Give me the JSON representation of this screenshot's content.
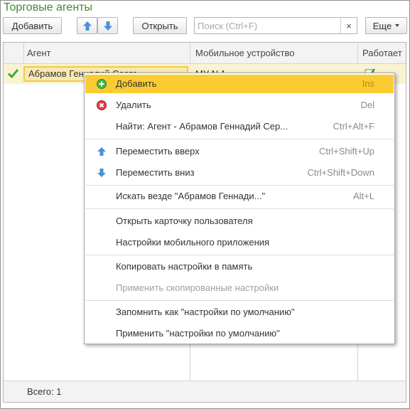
{
  "window": {
    "title": "Торговые агенты"
  },
  "toolbar": {
    "add_label": "Добавить",
    "open_label": "Открыть",
    "search_placeholder": "Поиск (Ctrl+F)",
    "search_clear": "×",
    "more_label": "Еще"
  },
  "table": {
    "columns": [
      "Агент",
      "Мобильное устройство",
      "Работает"
    ],
    "rows": [
      {
        "agent": "Абрамов Геннадий Серге",
        "device": "МУ N 1",
        "works": true
      }
    ],
    "total_label": "Всего: 1"
  },
  "context_menu": {
    "items": [
      {
        "label": "Добавить",
        "shortcut": "Ins",
        "icon": "add-icon",
        "active": true,
        "enabled": true
      },
      {
        "label": "Удалить",
        "shortcut": "Del",
        "icon": "delete-icon",
        "enabled": true
      },
      {
        "label": "Найти: Агент - Абрамов Геннадий Сер...",
        "shortcut": "Ctrl+Alt+F",
        "enabled": true
      },
      {
        "label": "Переместить вверх",
        "shortcut": "Ctrl+Shift+Up",
        "icon": "arrow-up-icon",
        "enabled": true
      },
      {
        "label": "Переместить вниз",
        "shortcut": "Ctrl+Shift+Down",
        "icon": "arrow-down-icon",
        "enabled": true
      },
      {
        "label": "Искать везде \"Абрамов Геннади...\"",
        "shortcut": "Alt+L",
        "enabled": true
      },
      {
        "label": "Открыть карточку пользователя",
        "shortcut": "",
        "enabled": true
      },
      {
        "label": "Настройки мобильного приложения",
        "shortcut": "",
        "enabled": true
      },
      {
        "label": "Копировать настройки в память",
        "shortcut": "",
        "enabled": true
      },
      {
        "label": "Применить скопированные настройки",
        "shortcut": "",
        "enabled": false
      },
      {
        "label": "Запомнить как \"настройки по умолчанию\"",
        "shortcut": "",
        "enabled": true
      },
      {
        "label": "Применить \"настройки по умолчанию\"",
        "shortcut": "",
        "enabled": true
      }
    ]
  },
  "colors": {
    "title": "#3b8f2a",
    "active_menu": "#fbcc32",
    "row_highlight": "#faf3d2",
    "arrow_blue": "#4a90d9"
  }
}
